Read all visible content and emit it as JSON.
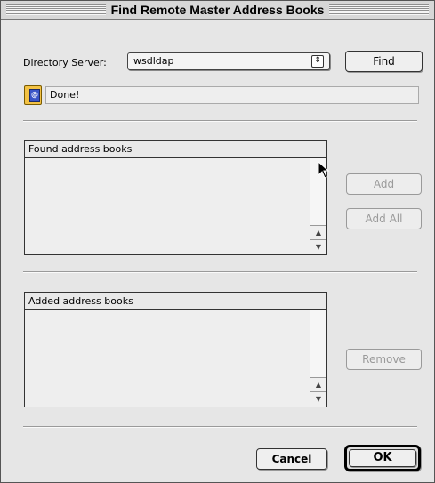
{
  "window": {
    "title": "Find Remote Master Address Books"
  },
  "directory": {
    "label": "Directory Server:",
    "selected": "wsdldap",
    "find_label": "Find"
  },
  "status": {
    "text": "Done!"
  },
  "found_list": {
    "header": "Found address books",
    "items": []
  },
  "added_list": {
    "header": "Added address books",
    "items": []
  },
  "buttons": {
    "add": "Add",
    "add_all": "Add All",
    "remove": "Remove",
    "cancel": "Cancel",
    "ok": "OK"
  },
  "icons": {
    "popup_arrows": "up-down-arrows-icon",
    "status": "address-book-icon",
    "cursor": "mouse-pointer-icon"
  }
}
